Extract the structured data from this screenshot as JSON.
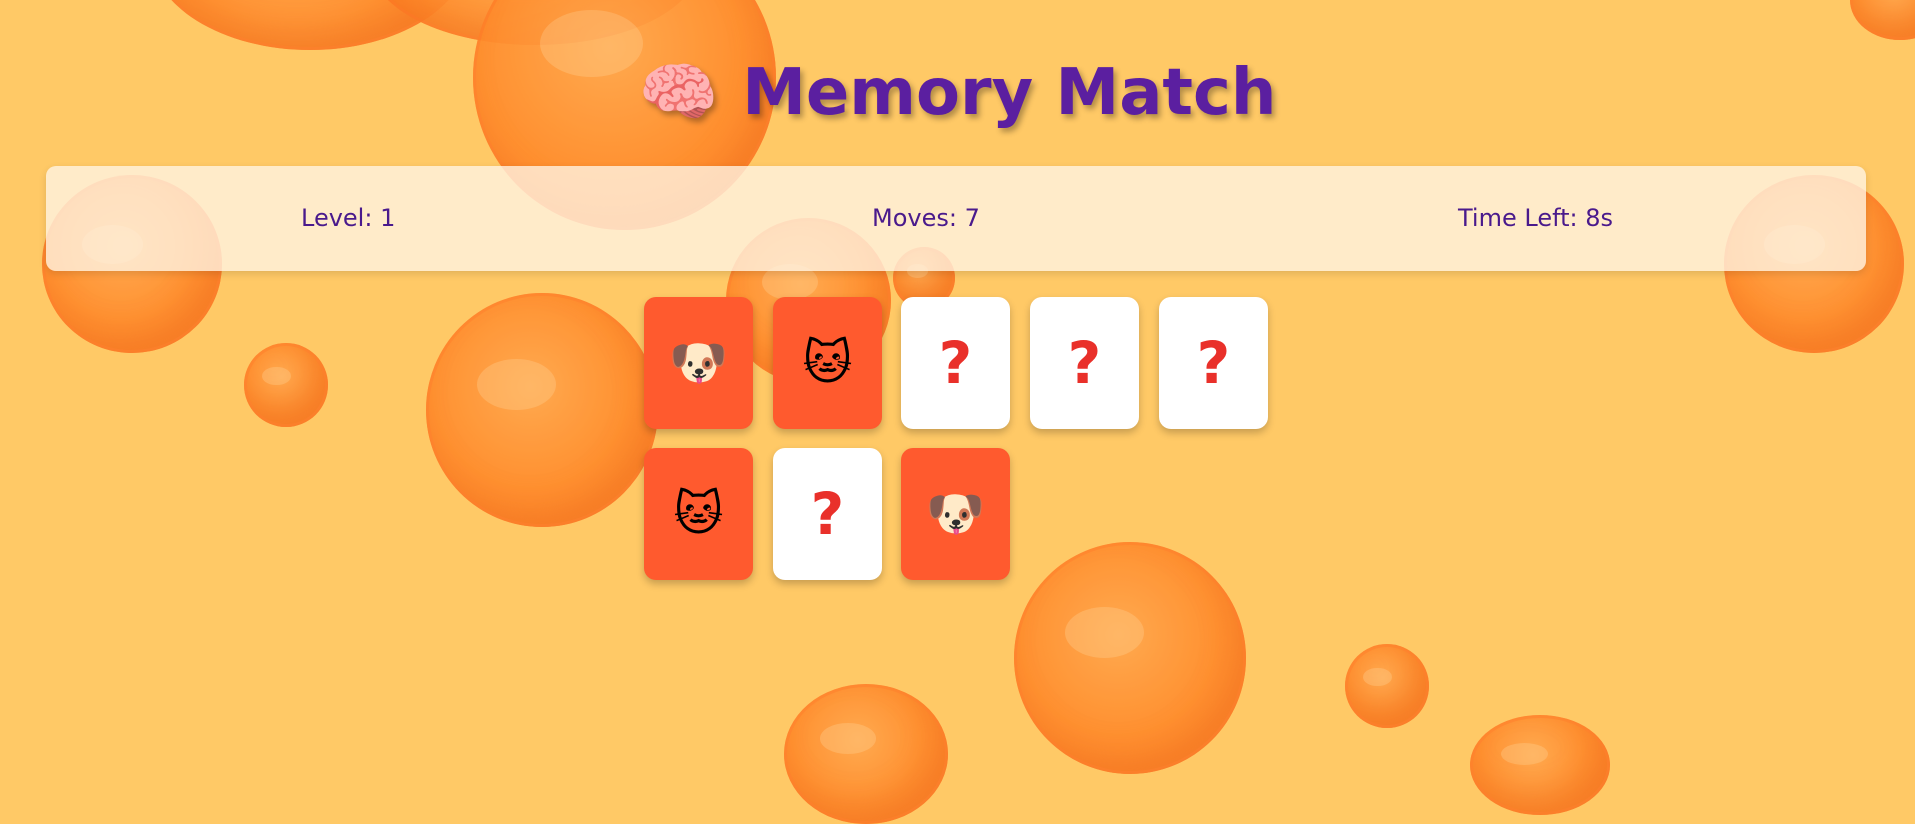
{
  "title": {
    "icon": "🧠",
    "text": "Memory Match"
  },
  "stats": {
    "level": "Level: 1",
    "moves": "Moves: 7",
    "time_left": "Time Left: 8s"
  },
  "cards": [
    {
      "face": "🐶",
      "state": "flipped",
      "icon": "dog-face-icon"
    },
    {
      "face": "🐱",
      "state": "flipped",
      "icon": "cat-face-icon"
    },
    {
      "face": "?",
      "state": "hidden",
      "icon": "question-mark-icon"
    },
    {
      "face": "?",
      "state": "hidden",
      "icon": "question-mark-icon"
    },
    {
      "face": "?",
      "state": "hidden",
      "icon": "question-mark-icon"
    },
    {
      "face": "🐱",
      "state": "flipped",
      "icon": "cat-face-icon"
    },
    {
      "face": "?",
      "state": "hidden",
      "icon": "question-mark-icon"
    },
    {
      "face": "🐶",
      "state": "flipped",
      "icon": "dog-face-icon"
    }
  ],
  "colors": {
    "background": "#ffc966",
    "title": "#5b1fa0",
    "card_flipped": "#ff5a2e",
    "card_hidden": "#ffffff",
    "question_mark": "#e9302a",
    "stat_text": "#4a1a8c"
  }
}
